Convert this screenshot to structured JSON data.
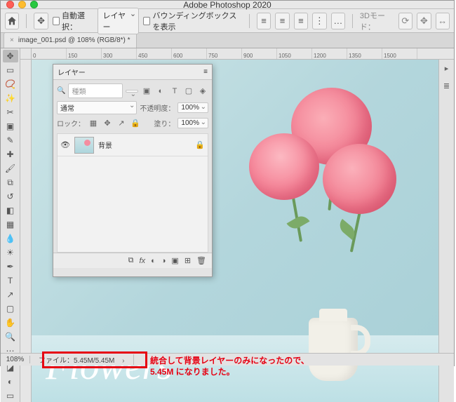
{
  "titlebar": {
    "title": "Adobe Photoshop 2020"
  },
  "options": {
    "autoselect_label": "自動選択：",
    "autoselect_target": "レイヤー",
    "show_bbox_label": "バウンディングボックスを表示",
    "mode3d_label": "3Dモード："
  },
  "doc_tab": {
    "name": "image_001.psd @ 108% (RGB/8*) *"
  },
  "ruler_ticks": [
    "0",
    "150",
    "300",
    "450",
    "600",
    "750",
    "900",
    "1050",
    "1200",
    "1350",
    "1500"
  ],
  "canvas": {
    "heading_text": "Flowers"
  },
  "layers_panel": {
    "title": "レイヤー",
    "search_placeholder": "種類",
    "blend_mode": "通常",
    "opacity_label": "不透明度：",
    "opacity_value": "100%",
    "lock_label": "ロック：",
    "fill_label": "塗り：",
    "fill_value": "100%",
    "layer": {
      "name": "背景"
    }
  },
  "status": {
    "zoom": "108%",
    "file_info": "ファイル：5.45M/5.45M"
  },
  "annotation": {
    "line1": "統合して背景レイヤーのみになったので、",
    "line2": "5.45M になりました。"
  }
}
